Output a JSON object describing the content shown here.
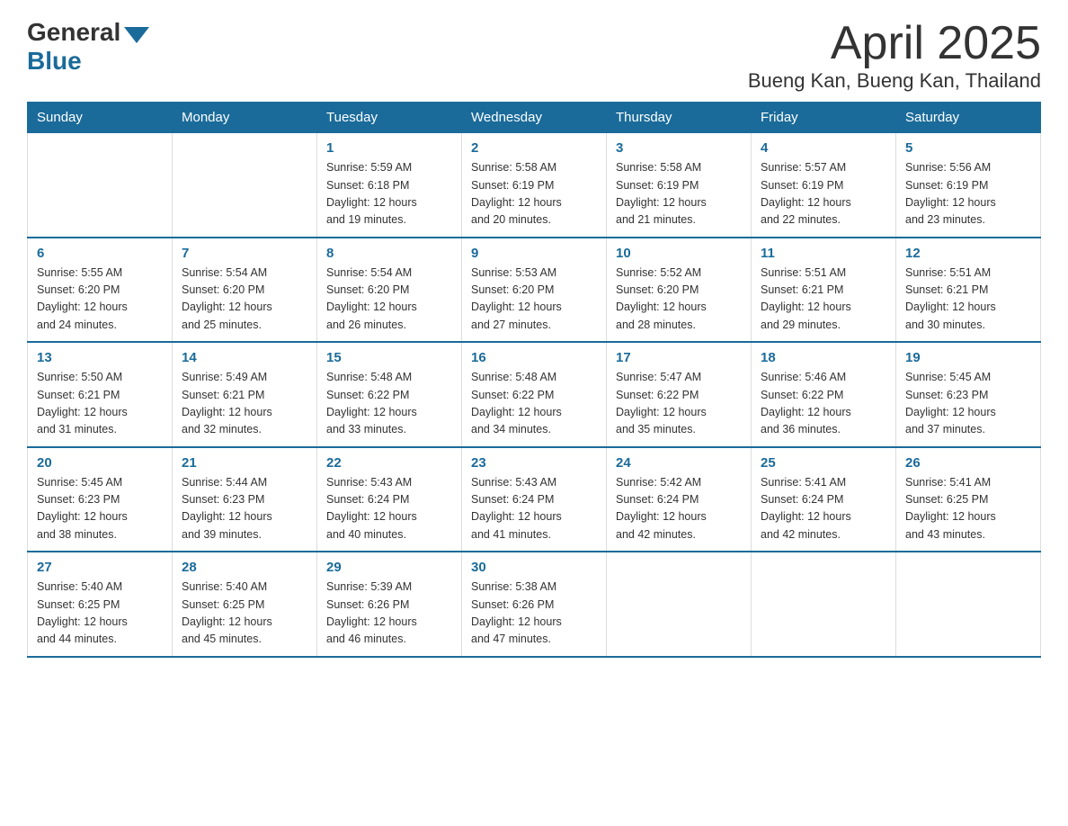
{
  "logo": {
    "general": "General",
    "blue": "Blue"
  },
  "title": "April 2025",
  "subtitle": "Bueng Kan, Bueng Kan, Thailand",
  "weekdays": [
    "Sunday",
    "Monday",
    "Tuesday",
    "Wednesday",
    "Thursday",
    "Friday",
    "Saturday"
  ],
  "weeks": [
    [
      {
        "day": "",
        "info": ""
      },
      {
        "day": "",
        "info": ""
      },
      {
        "day": "1",
        "info": "Sunrise: 5:59 AM\nSunset: 6:18 PM\nDaylight: 12 hours\nand 19 minutes."
      },
      {
        "day": "2",
        "info": "Sunrise: 5:58 AM\nSunset: 6:19 PM\nDaylight: 12 hours\nand 20 minutes."
      },
      {
        "day": "3",
        "info": "Sunrise: 5:58 AM\nSunset: 6:19 PM\nDaylight: 12 hours\nand 21 minutes."
      },
      {
        "day": "4",
        "info": "Sunrise: 5:57 AM\nSunset: 6:19 PM\nDaylight: 12 hours\nand 22 minutes."
      },
      {
        "day": "5",
        "info": "Sunrise: 5:56 AM\nSunset: 6:19 PM\nDaylight: 12 hours\nand 23 minutes."
      }
    ],
    [
      {
        "day": "6",
        "info": "Sunrise: 5:55 AM\nSunset: 6:20 PM\nDaylight: 12 hours\nand 24 minutes."
      },
      {
        "day": "7",
        "info": "Sunrise: 5:54 AM\nSunset: 6:20 PM\nDaylight: 12 hours\nand 25 minutes."
      },
      {
        "day": "8",
        "info": "Sunrise: 5:54 AM\nSunset: 6:20 PM\nDaylight: 12 hours\nand 26 minutes."
      },
      {
        "day": "9",
        "info": "Sunrise: 5:53 AM\nSunset: 6:20 PM\nDaylight: 12 hours\nand 27 minutes."
      },
      {
        "day": "10",
        "info": "Sunrise: 5:52 AM\nSunset: 6:20 PM\nDaylight: 12 hours\nand 28 minutes."
      },
      {
        "day": "11",
        "info": "Sunrise: 5:51 AM\nSunset: 6:21 PM\nDaylight: 12 hours\nand 29 minutes."
      },
      {
        "day": "12",
        "info": "Sunrise: 5:51 AM\nSunset: 6:21 PM\nDaylight: 12 hours\nand 30 minutes."
      }
    ],
    [
      {
        "day": "13",
        "info": "Sunrise: 5:50 AM\nSunset: 6:21 PM\nDaylight: 12 hours\nand 31 minutes."
      },
      {
        "day": "14",
        "info": "Sunrise: 5:49 AM\nSunset: 6:21 PM\nDaylight: 12 hours\nand 32 minutes."
      },
      {
        "day": "15",
        "info": "Sunrise: 5:48 AM\nSunset: 6:22 PM\nDaylight: 12 hours\nand 33 minutes."
      },
      {
        "day": "16",
        "info": "Sunrise: 5:48 AM\nSunset: 6:22 PM\nDaylight: 12 hours\nand 34 minutes."
      },
      {
        "day": "17",
        "info": "Sunrise: 5:47 AM\nSunset: 6:22 PM\nDaylight: 12 hours\nand 35 minutes."
      },
      {
        "day": "18",
        "info": "Sunrise: 5:46 AM\nSunset: 6:22 PM\nDaylight: 12 hours\nand 36 minutes."
      },
      {
        "day": "19",
        "info": "Sunrise: 5:45 AM\nSunset: 6:23 PM\nDaylight: 12 hours\nand 37 minutes."
      }
    ],
    [
      {
        "day": "20",
        "info": "Sunrise: 5:45 AM\nSunset: 6:23 PM\nDaylight: 12 hours\nand 38 minutes."
      },
      {
        "day": "21",
        "info": "Sunrise: 5:44 AM\nSunset: 6:23 PM\nDaylight: 12 hours\nand 39 minutes."
      },
      {
        "day": "22",
        "info": "Sunrise: 5:43 AM\nSunset: 6:24 PM\nDaylight: 12 hours\nand 40 minutes."
      },
      {
        "day": "23",
        "info": "Sunrise: 5:43 AM\nSunset: 6:24 PM\nDaylight: 12 hours\nand 41 minutes."
      },
      {
        "day": "24",
        "info": "Sunrise: 5:42 AM\nSunset: 6:24 PM\nDaylight: 12 hours\nand 42 minutes."
      },
      {
        "day": "25",
        "info": "Sunrise: 5:41 AM\nSunset: 6:24 PM\nDaylight: 12 hours\nand 42 minutes."
      },
      {
        "day": "26",
        "info": "Sunrise: 5:41 AM\nSunset: 6:25 PM\nDaylight: 12 hours\nand 43 minutes."
      }
    ],
    [
      {
        "day": "27",
        "info": "Sunrise: 5:40 AM\nSunset: 6:25 PM\nDaylight: 12 hours\nand 44 minutes."
      },
      {
        "day": "28",
        "info": "Sunrise: 5:40 AM\nSunset: 6:25 PM\nDaylight: 12 hours\nand 45 minutes."
      },
      {
        "day": "29",
        "info": "Sunrise: 5:39 AM\nSunset: 6:26 PM\nDaylight: 12 hours\nand 46 minutes."
      },
      {
        "day": "30",
        "info": "Sunrise: 5:38 AM\nSunset: 6:26 PM\nDaylight: 12 hours\nand 47 minutes."
      },
      {
        "day": "",
        "info": ""
      },
      {
        "day": "",
        "info": ""
      },
      {
        "day": "",
        "info": ""
      }
    ]
  ]
}
